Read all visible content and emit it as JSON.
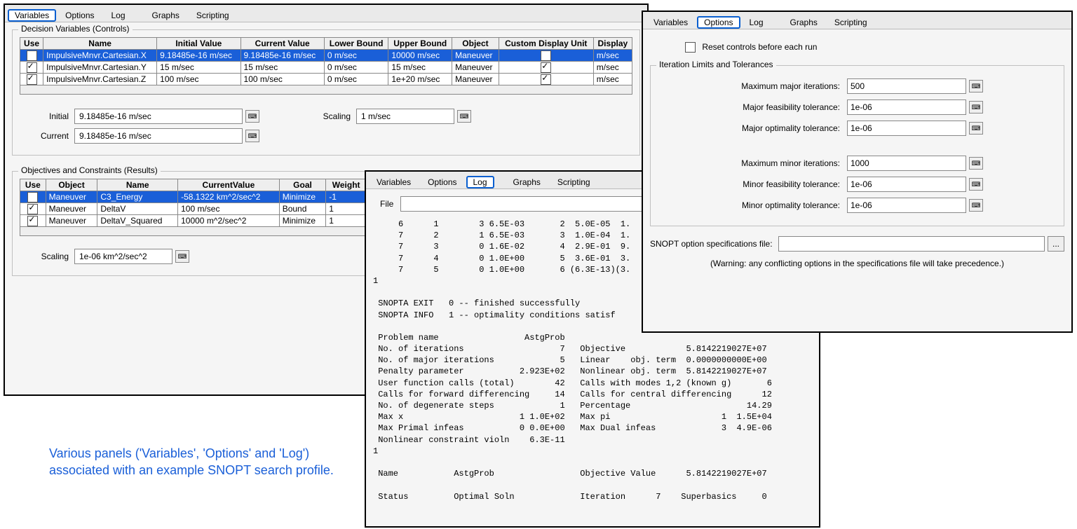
{
  "caption": "Various panels ('Variables', 'Options' and 'Log') associated with an example SNOPT search profile.",
  "tabs": [
    "Variables",
    "Options",
    "Log",
    "Graphs",
    "Scripting"
  ],
  "variables_panel": {
    "group1_title": "Decision Variables (Controls)",
    "headers": [
      "Use",
      "Name",
      "Initial Value",
      "Current Value",
      "Lower Bound",
      "Upper Bound",
      "Object",
      "Custom Display Unit",
      "Display"
    ],
    "rows": [
      {
        "use": true,
        "name": "ImpulsiveMnvr.Cartesian.X",
        "initial": "9.18485e-16 m/sec",
        "current": "9.18485e-16 m/sec",
        "lower": "0 m/sec",
        "upper": "10000 m/sec",
        "object": "Maneuver",
        "custom": true,
        "display": "m/sec",
        "selected": true
      },
      {
        "use": true,
        "name": "ImpulsiveMnvr.Cartesian.Y",
        "initial": "15 m/sec",
        "current": "15 m/sec",
        "lower": "0 m/sec",
        "upper": "15 m/sec",
        "object": "Maneuver",
        "custom": true,
        "display": "m/sec",
        "selected": false
      },
      {
        "use": true,
        "name": "ImpulsiveMnvr.Cartesian.Z",
        "initial": "100 m/sec",
        "current": "100 m/sec",
        "lower": "0 m/sec",
        "upper": "1e+20 m/sec",
        "object": "Maneuver",
        "custom": true,
        "display": "m/sec",
        "selected": false
      }
    ],
    "initial_label": "Initial",
    "initial_value": "9.18485e-16 m/sec",
    "current_label": "Current",
    "current_value": "9.18485e-16 m/sec",
    "scaling_label": "Scaling",
    "scaling_value": "1 m/sec",
    "group2_title": "Objectives and Constraints (Results)",
    "headers2": [
      "Use",
      "Object",
      "Name",
      "CurrentValue",
      "Goal",
      "Weight"
    ],
    "rows2": [
      {
        "use": true,
        "object": "Maneuver",
        "name": "C3_Energy",
        "current": "-58.1322 km^2/sec^2",
        "goal": "Minimize",
        "weight": "-1",
        "selected": true
      },
      {
        "use": true,
        "object": "Maneuver",
        "name": "DeltaV",
        "current": "100 m/sec",
        "goal": "Bound",
        "weight": "1",
        "selected": false
      },
      {
        "use": true,
        "object": "Maneuver",
        "name": "DeltaV_Squared",
        "current": "10000 m^2/sec^2",
        "goal": "Minimize",
        "weight": "1",
        "selected": false
      }
    ],
    "scaling2_label": "Scaling",
    "scaling2_value": "1e-06 km^2/sec^2"
  },
  "options_panel": {
    "reset_label": "Reset controls before each run",
    "group_title": "Iteration Limits and Tolerances",
    "fields": [
      {
        "label": "Maximum major iterations:",
        "value": "500"
      },
      {
        "label": "Major feasibility tolerance:",
        "value": "1e-06"
      },
      {
        "label": "Major optimality tolerance:",
        "value": "1e-06"
      },
      {
        "label": "Maximum minor iterations:",
        "value": "1000"
      },
      {
        "label": "Minor feasibility tolerance:",
        "value": "1e-06"
      },
      {
        "label": "Minor optimality tolerance:",
        "value": "1e-06"
      }
    ],
    "spec_label": "SNOPT option specifications file:",
    "spec_value": "",
    "warning": "(Warning: any conflicting options in the specifications file will take precedence.)"
  },
  "log_panel": {
    "file_label": "File",
    "file_value": "",
    "log_text": "     6      1        3 6.5E-03       2  5.0E-05  1.\n     7      2        1 6.5E-03       3  1.0E-04  1.\n     7      3        0 1.6E-02       4  2.9E-01  9.\n     7      4        0 1.0E+00       5  3.6E-01  3.\n     7      5        0 1.0E+00       6 (6.3E-13)(3.\n1\n\n SNOPTA EXIT   0 -- finished successfully\n SNOPTA INFO   1 -- optimality conditions satisf\n\n Problem name                 AstgProb\n No. of iterations                   7   Objective            5.8142219027E+07\n No. of major iterations             5   Linear    obj. term  0.0000000000E+00\n Penalty parameter           2.923E+02   Nonlinear obj. term  5.8142219027E+07\n User function calls (total)        42   Calls with modes 1,2 (known g)       6\n Calls for forward differencing     14   Calls for central differencing      12\n No. of degenerate steps             1   Percentage                       14.29\n Max x                       1 1.0E+02   Max pi                      1  1.5E+04\n Max Primal infeas           0 0.0E+00   Max Dual infeas             3  4.9E-06\n Nonlinear constraint violn    6.3E-11\n1\n\n Name           AstgProb                 Objective Value      5.8142219027E+07\n\n Status         Optimal Soln             Iteration      7    Superbasics     0"
  }
}
